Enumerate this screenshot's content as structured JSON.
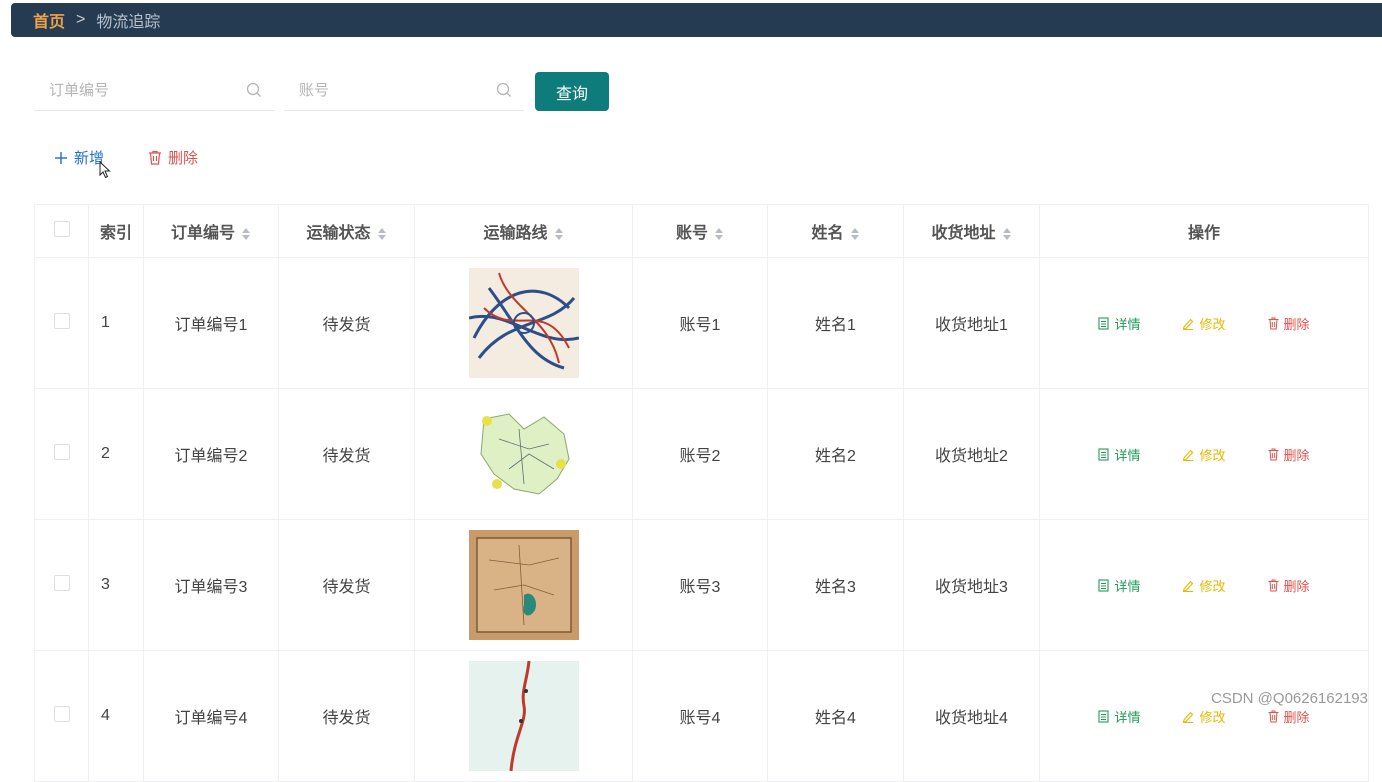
{
  "breadcrumb": {
    "home": "首页",
    "separator": ">",
    "current": "物流追踪"
  },
  "search": {
    "order_placeholder": "订单编号",
    "account_placeholder": "账号",
    "query_label": "查询"
  },
  "actions": {
    "add_label": "新增",
    "delete_label": "删除"
  },
  "table": {
    "headers": {
      "index": "索引",
      "order_no": "订单编号",
      "status": "运输状态",
      "route": "运输路线",
      "account": "账号",
      "name": "姓名",
      "address": "收货地址",
      "ops": "操作"
    },
    "row_actions": {
      "detail": "详情",
      "edit": "修改",
      "delete": "删除"
    },
    "rows": [
      {
        "index": "1",
        "order_no": "订单编号1",
        "status": "待发货",
        "account": "账号1",
        "name": "姓名1",
        "address": "收货地址1",
        "route_image": "route-map-1"
      },
      {
        "index": "2",
        "order_no": "订单编号2",
        "status": "待发货",
        "account": "账号2",
        "name": "姓名2",
        "address": "收货地址2",
        "route_image": "route-map-2"
      },
      {
        "index": "3",
        "order_no": "订单编号3",
        "status": "待发货",
        "account": "账号3",
        "name": "姓名3",
        "address": "收货地址3",
        "route_image": "route-map-3"
      },
      {
        "index": "4",
        "order_no": "订单编号4",
        "status": "待发货",
        "account": "账号4",
        "name": "姓名4",
        "address": "收货地址4",
        "route_image": "route-map-4"
      }
    ]
  },
  "watermark": "CSDN @Q0626162193",
  "colors": {
    "topbar": "#253b52",
    "primary": "#0e7c7b",
    "home": "#f0a24a",
    "add": "#1e6fcf",
    "danger": "#e0524b",
    "detail": "#1f9d55",
    "edit": "#e6b800"
  }
}
